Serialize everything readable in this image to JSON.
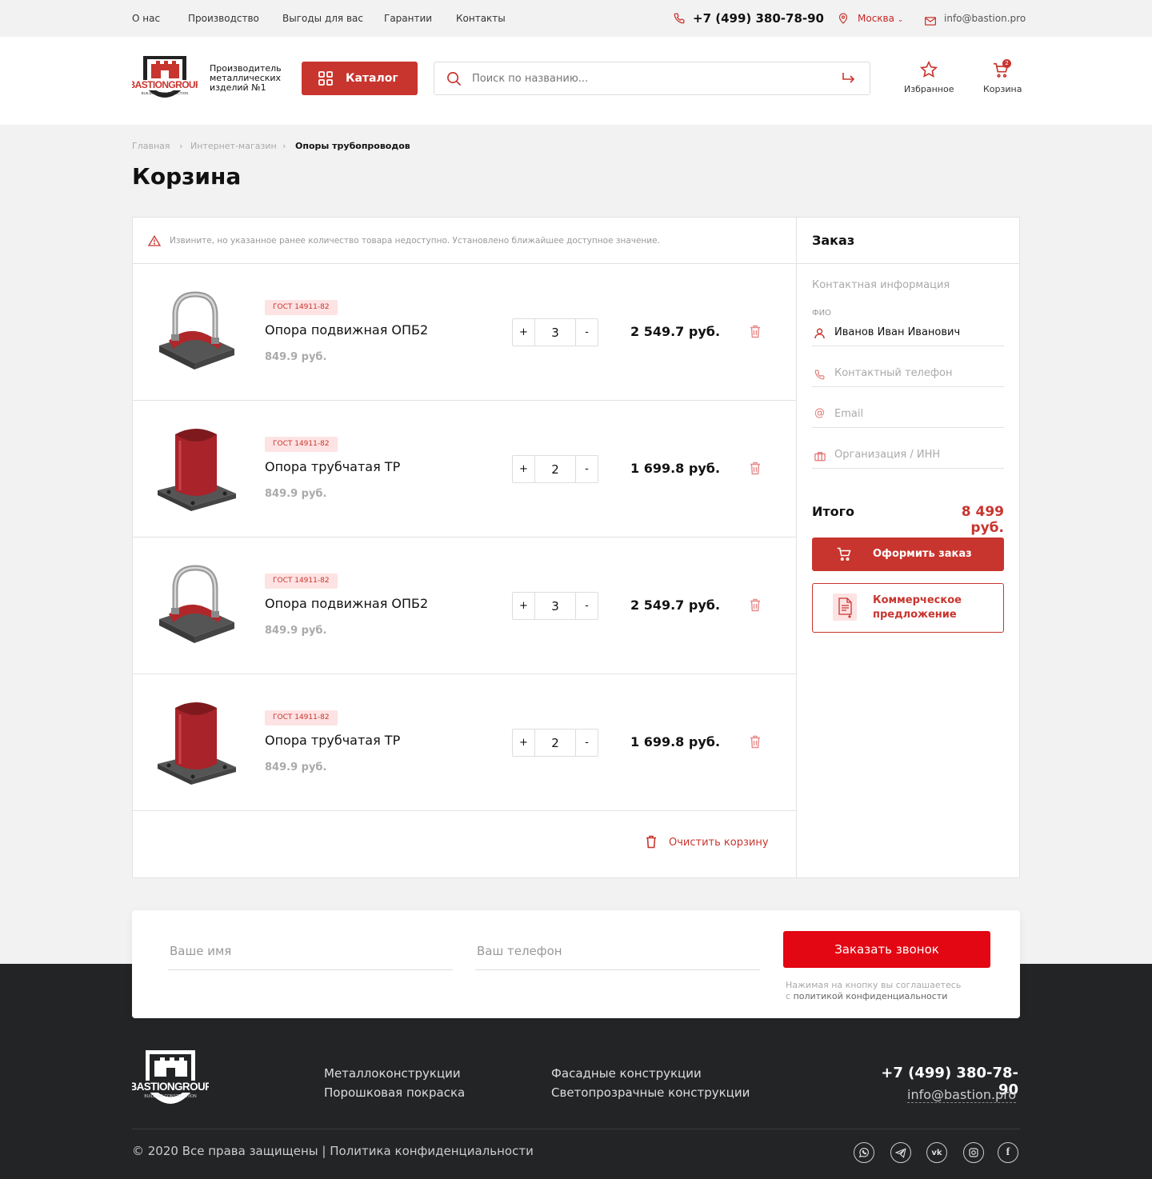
{
  "topbar": {
    "nav": [
      "О нас",
      "Производство",
      "Выгоды для вас",
      "Гарантии",
      "Контакты"
    ],
    "phone": "+7 (499) 380-78-90",
    "city": "Москва",
    "email": "info@bastion.pro"
  },
  "header": {
    "logo_text": "BASTIONGROUP",
    "logo_sub": "BUILDING CONSTRUCTION",
    "tagline": "Производитель металлических изделий №1",
    "catalog_label": "Каталог",
    "search_placeholder": "Поиск по названию...",
    "favorites_label": "Избранное",
    "cart_label": "Корзина",
    "cart_count": "2"
  },
  "breadcrumb": [
    "Главная",
    "Интернет-магазин",
    "Опоры трубопроводов"
  ],
  "page_title": "Корзина",
  "cart": {
    "notice": "Извините, но указанное  ранее количество товара недоступно. Установлено ближайшее доступное значение.",
    "items": [
      {
        "gost": "ГОСТ 14911-82",
        "name": "Опора подвижная ОПБ2",
        "price": "849.9 руб.",
        "qty": "3",
        "total": "2 549.7 руб.",
        "kind": "clamp"
      },
      {
        "gost": "ГОСТ 14911-82",
        "name": "Опора трубчатая ТР",
        "price": "849.9 руб.",
        "qty": "2",
        "total": "1 699.8 руб.",
        "kind": "tube"
      },
      {
        "gost": "ГОСТ 14911-82",
        "name": "Опора подвижная ОПБ2",
        "price": "849.9 руб.",
        "qty": "3",
        "total": "2 549.7 руб.",
        "kind": "clamp"
      },
      {
        "gost": "ГОСТ 14911-82",
        "name": "Опора трубчатая ТР",
        "price": "849.9 руб.",
        "qty": "2",
        "total": "1 699.8 руб.",
        "kind": "tube"
      }
    ],
    "plus": "+",
    "minus": "-",
    "clear_label": "Очистить корзину"
  },
  "order": {
    "title": "Заказ",
    "contact_title": "Контактная информация",
    "fio_label": "ФИО",
    "fio_value": "Иванов Иван Иванович",
    "phone_placeholder": "Контактный телефон",
    "email_placeholder": "Email",
    "org_placeholder": "Организация / ИНН",
    "total_label": "Итого",
    "total_value": "8 499 руб.",
    "submit_label": "Оформить заказ",
    "kp_label_1": "Коммерческое",
    "kp_label_2": "предложение"
  },
  "callback": {
    "name_placeholder": "Ваше имя",
    "phone_placeholder": "Ваш телефон",
    "button_label": "Заказать звонок",
    "note_1": "Нажимая на кнопку вы соглашаетесь",
    "note_2_prefix": "с",
    "note_2_link": "политикой конфиденциальности"
  },
  "footer": {
    "menu_col1": [
      "Металлоконструкции",
      "Порошковая покраска"
    ],
    "menu_col2": [
      "Фасадные конструкции",
      "Светопрозрачные конструкции"
    ],
    "phone": "+7 (499) 380-78-90",
    "email": "info@bastion.pro",
    "copyright": "© 2020 Все права защищены | Политика конфиденциальности",
    "social": [
      "whatsapp-icon",
      "telegram-icon",
      "vk-icon",
      "instagram-icon",
      "facebook-icon"
    ]
  },
  "colors": {
    "accent": "#c8352e",
    "callback_button": "#e30613",
    "footer_bg": "#222426"
  }
}
